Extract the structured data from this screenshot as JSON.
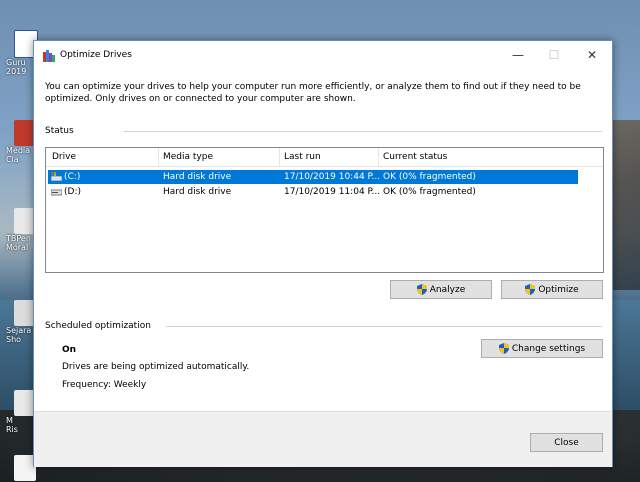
{
  "desktop": {
    "icons": [
      {
        "label": "Guru\n2019",
        "color": "#2b579a"
      },
      {
        "label": "Media\nCla",
        "color": "#c0392b"
      },
      {
        "label": "TBPen\nMoral",
        "color": "#e8e8e8"
      },
      {
        "label": "Sejara\nSho",
        "color": "#dcdcdc"
      },
      {
        "label": "M\nRis",
        "color": "#e8e8e8"
      },
      {
        "label": "",
        "color": "#f4f4f4"
      }
    ]
  },
  "window": {
    "title": "Optimize Drives",
    "controls": {
      "minimize": "—",
      "maximize": "☐",
      "close": "✕"
    },
    "description": "You can optimize your drives to help your computer run more efficiently, or analyze them to find out if they need to be optimized. Only drives on or connected to your computer are shown.",
    "status_label": "Status",
    "columns": [
      "Drive",
      "Media type",
      "Last run",
      "Current status"
    ],
    "drives": [
      {
        "drive": "(C:)",
        "media": "Hard disk drive",
        "last_run": "17/10/2019 10:44 P...",
        "status": "OK (0% fragmented)",
        "selected": true,
        "icon": "windows-drive-icon"
      },
      {
        "drive": "(D:)",
        "media": "Hard disk drive",
        "last_run": "17/10/2019 11:04 P...",
        "status": "OK (0% fragmented)",
        "selected": false,
        "icon": "drive-icon"
      }
    ],
    "analyze_button": "Analyze",
    "optimize_button": "Optimize",
    "scheduled_label": "Scheduled optimization",
    "schedule_state": "On",
    "schedule_desc": "Drives are being optimized automatically.",
    "frequency": "Frequency: Weekly",
    "change_settings_button": "Change settings",
    "close_button": "Close",
    "accent_color": "#0078d7"
  }
}
